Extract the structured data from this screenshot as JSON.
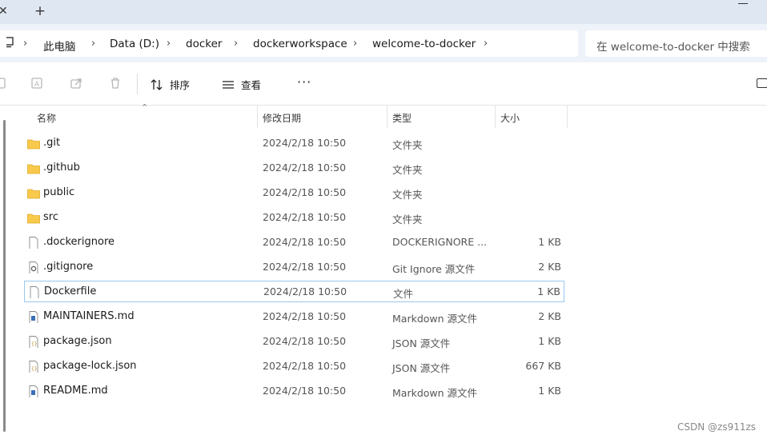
{
  "tabstrip": {
    "close_icon": "close-icon",
    "new_tab_glyph": "+"
  },
  "breadcrumb": {
    "items": [
      "此电脑",
      "Data (D:)",
      "docker",
      "dockerworkspace",
      "welcome-to-docker"
    ]
  },
  "search": {
    "placeholder": "在 welcome-to-docker 中搜索"
  },
  "toolbar": {
    "sort_label": "排序",
    "view_label": "查看",
    "more_label": "···"
  },
  "columns": {
    "name": "名称",
    "date": "修改日期",
    "type": "类型",
    "size": "大小"
  },
  "files": [
    {
      "name": ".git",
      "date": "2024/2/18 10:50",
      "type": "文件夹",
      "size": "",
      "icon": "folder-icon"
    },
    {
      "name": ".github",
      "date": "2024/2/18 10:50",
      "type": "文件夹",
      "size": "",
      "icon": "folder-icon"
    },
    {
      "name": "public",
      "date": "2024/2/18 10:50",
      "type": "文件夹",
      "size": "",
      "icon": "folder-icon"
    },
    {
      "name": "src",
      "date": "2024/2/18 10:50",
      "type": "文件夹",
      "size": "",
      "icon": "folder-icon"
    },
    {
      "name": ".dockerignore",
      "date": "2024/2/18 10:50",
      "type": "DOCKERIGNORE ...",
      "size": "1 KB",
      "icon": "file-icon"
    },
    {
      "name": ".gitignore",
      "date": "2024/2/18 10:50",
      "type": "Git Ignore 源文件",
      "size": "2 KB",
      "icon": "settings-file-icon"
    },
    {
      "name": "Dockerfile",
      "date": "2024/2/18 10:50",
      "type": "文件",
      "size": "1 KB",
      "icon": "file-icon"
    },
    {
      "name": "MAINTAINERS.md",
      "date": "2024/2/18 10:50",
      "type": "Markdown 源文件",
      "size": "2 KB",
      "icon": "markdown-file-icon"
    },
    {
      "name": "package.json",
      "date": "2024/2/18 10:50",
      "type": "JSON 源文件",
      "size": "1 KB",
      "icon": "json-file-icon"
    },
    {
      "name": "package-lock.json",
      "date": "2024/2/18 10:50",
      "type": "JSON 源文件",
      "size": "667 KB",
      "icon": "json-file-icon"
    },
    {
      "name": "README.md",
      "date": "2024/2/18 10:50",
      "type": "Markdown 源文件",
      "size": "1 KB",
      "icon": "markdown-file-icon"
    }
  ],
  "selected_file": "Dockerfile",
  "watermark": "CSDN @zs911zs",
  "colors": {
    "folder": "#f8c94a",
    "selection_border": "#99c6ee",
    "tabstrip": "#dfe7f2",
    "address_row": "#eef3fa"
  }
}
